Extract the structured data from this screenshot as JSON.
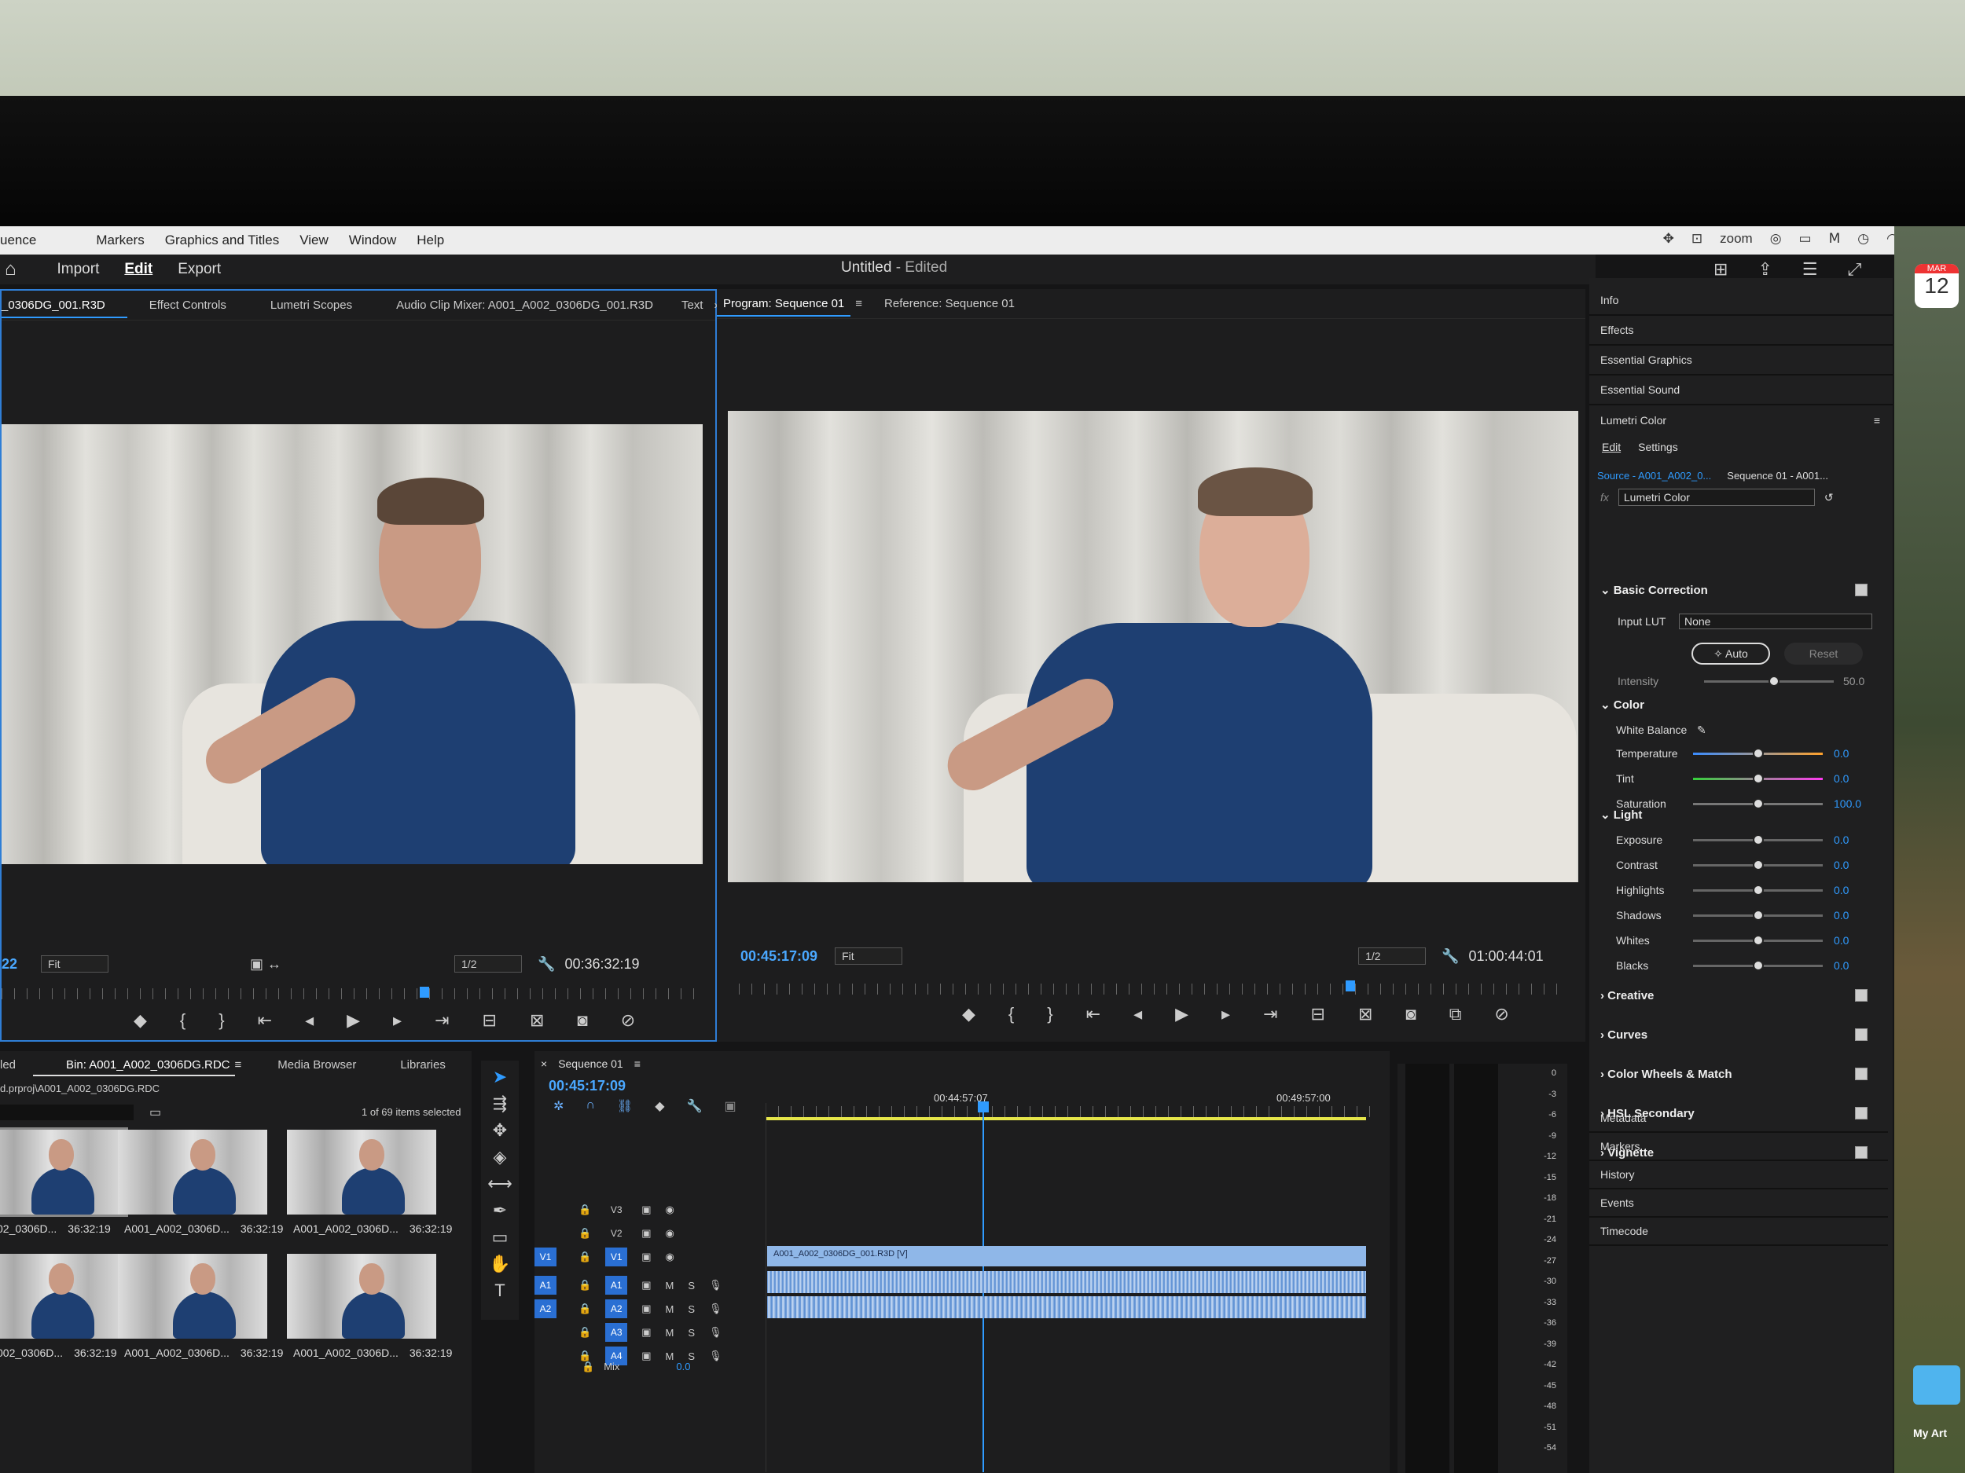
{
  "menu": {
    "items": [
      "uence",
      "Markers",
      "Graphics and Titles",
      "View",
      "Window",
      "Help"
    ],
    "zoom": "zoom"
  },
  "titlebar": {
    "home": "⌂",
    "import": "Import",
    "edit": "Edit",
    "export": "Export",
    "title_main": "Untitled",
    "title_suffix": "- Edited"
  },
  "source_panel": {
    "tabs": [
      "_0306DG_001.R3D",
      "Effect Controls",
      "Lumetri Scopes",
      "Audio Clip Mixer: A001_A002_0306DG_001.R3D",
      "Text"
    ],
    "more": "»",
    "timecode_left": "22",
    "fit": "Fit",
    "res": "1/2",
    "timecode_right": "00:36:32:19"
  },
  "program_panel": {
    "tabs": [
      "Program: Sequence 01",
      "Reference: Sequence 01"
    ],
    "timecode_left": "00:45:17:09",
    "fit": "Fit",
    "res": "1/2",
    "timecode_right": "01:00:44:01"
  },
  "right_panel": {
    "items": [
      "Info",
      "Effects",
      "Essential Graphics",
      "Essential Sound",
      "Lumetri Color"
    ],
    "edit_tab": "Edit",
    "settings_tab": "Settings",
    "source": "Source - A001_A002_0...",
    "sequence": "Sequence 01 - A001...",
    "fx": "fx",
    "effect": "Lumetri Color",
    "basic_correction": "Basic Correction",
    "input_lut_label": "Input LUT",
    "input_lut": "None",
    "auto": "Auto",
    "reset": "Reset",
    "intensity_label": "Intensity",
    "intensity": "50.0",
    "color": "Color",
    "white_balance": "White Balance",
    "color_rows": [
      {
        "label": "Temperature",
        "value": "0.0"
      },
      {
        "label": "Tint",
        "value": "0.0"
      },
      {
        "label": "Saturation",
        "value": "100.0"
      }
    ],
    "light": "Light",
    "light_rows": [
      {
        "label": "Exposure",
        "value": "0.0"
      },
      {
        "label": "Contrast",
        "value": "0.0"
      },
      {
        "label": "Highlights",
        "value": "0.0"
      },
      {
        "label": "Shadows",
        "value": "0.0"
      },
      {
        "label": "Whites",
        "value": "0.0"
      },
      {
        "label": "Blacks",
        "value": "0.0"
      }
    ],
    "sections": [
      "Creative",
      "Curves",
      "Color Wheels & Match",
      "HSL Secondary",
      "Vignette"
    ],
    "bottom_items": [
      "Metadata",
      "Markers",
      "History",
      "Events",
      "Timecode"
    ]
  },
  "project_panel": {
    "tabs": [
      "led",
      "Bin: A001_A002_0306DG.RDC",
      "Media Browser",
      "Libraries"
    ],
    "path": "d.prproj\\A001_A002_0306DG.RDC",
    "selected": "1 of 69 items selected",
    "clips": [
      {
        "name": "02_0306D...",
        "dur": "36:32:19"
      },
      {
        "name": "A001_A002_0306D...",
        "dur": "36:32:19"
      },
      {
        "name": "A001_A002_0306D...",
        "dur": "36:32:19"
      },
      {
        "name": "002_0306D...",
        "dur": "36:32:19"
      },
      {
        "name": "A001_A002_0306D...",
        "dur": "36:32:19"
      },
      {
        "name": "A001_A002_0306D...",
        "dur": "36:32:19"
      }
    ]
  },
  "timeline": {
    "close": "×",
    "tab": "Sequence 01",
    "timecode": "00:45:17:09",
    "ruler_marks": [
      "00:44:57:07",
      "00:49:57:00"
    ],
    "clip_name": "A001_A002_0306DG_001.R3D [V]",
    "mix_label": "Mix",
    "mix_value": "0.0",
    "video_tracks": [
      "V3",
      "V2",
      "V1"
    ],
    "audio_tracks": [
      "A1",
      "A2",
      "A3",
      "A4"
    ],
    "src_video": "V1",
    "src_audio": [
      "A1",
      "A2"
    ],
    "track_m": "M",
    "track_s": "S"
  },
  "meters": [
    "0",
    "-3",
    "-6",
    "-9",
    "-12",
    "-15",
    "-18",
    "-21",
    "-24",
    "-27",
    "-30",
    "-33",
    "-36",
    "-39",
    "-42",
    "-45",
    "-48",
    "-51",
    "-54"
  ],
  "desktop": {
    "calendar_month": "MAR",
    "calendar_day": "12",
    "folder": "My Art"
  }
}
